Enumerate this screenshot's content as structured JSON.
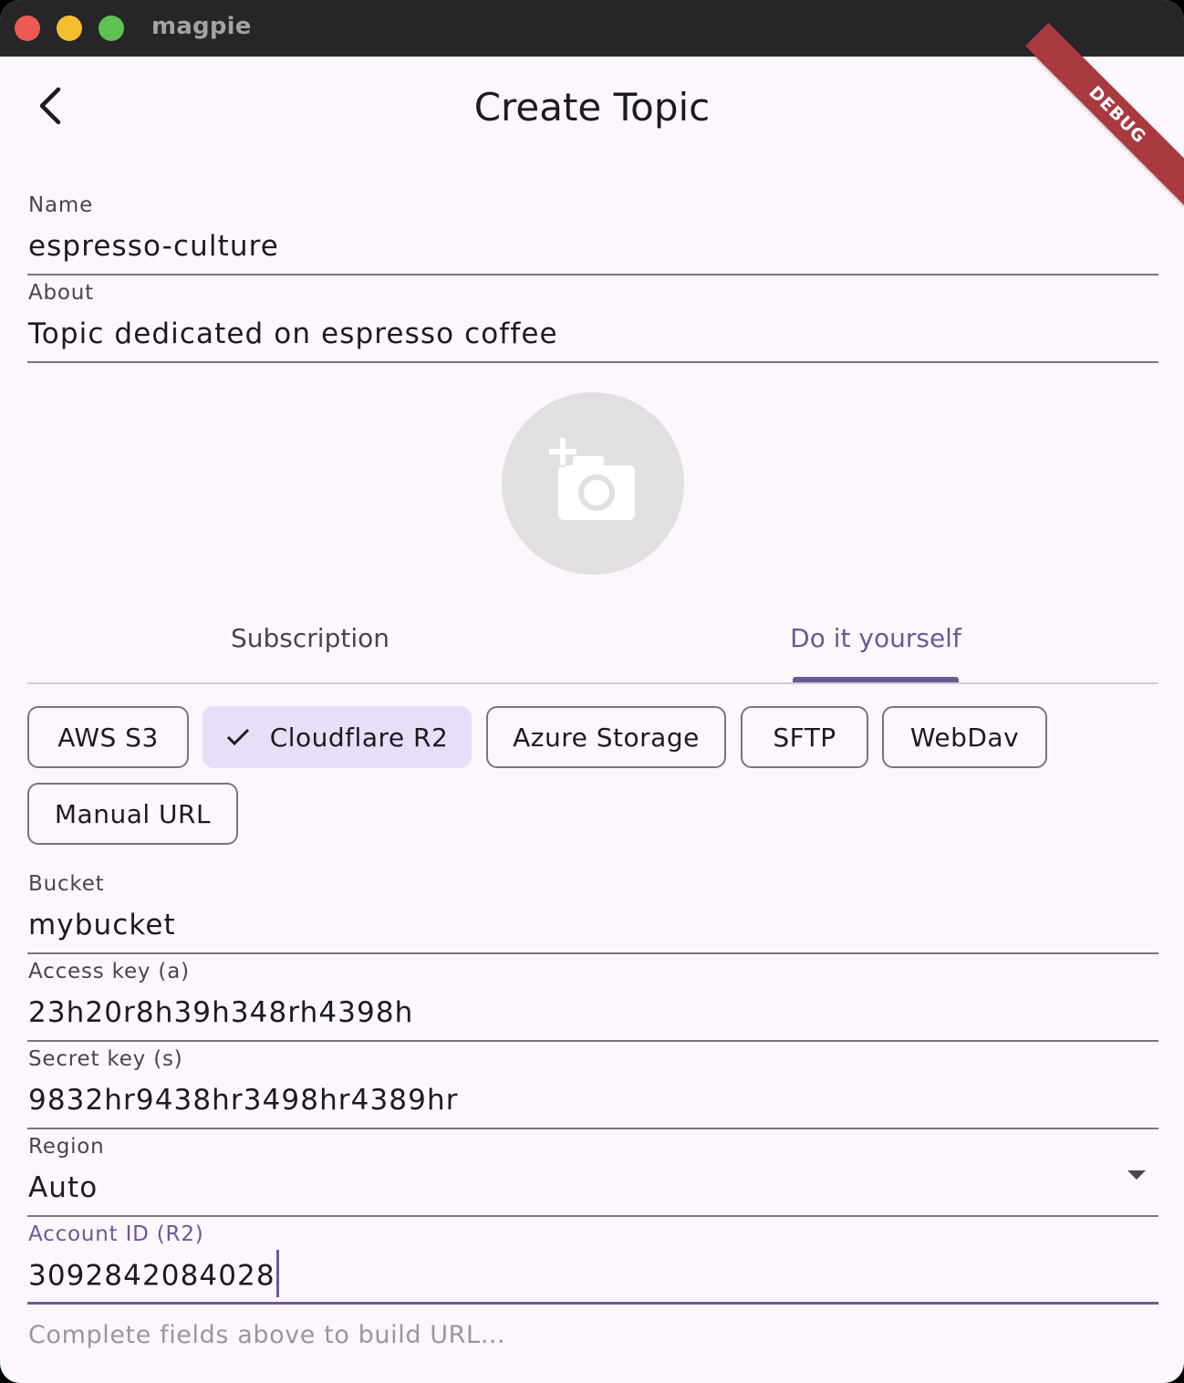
{
  "window": {
    "app_title": "magpie",
    "debug_banner": "DEBUG"
  },
  "header": {
    "title": "Create Topic"
  },
  "form": {
    "name": {
      "label": "Name",
      "value": "espresso-culture"
    },
    "about": {
      "label": "About",
      "value": "Topic dedicated on espresso coffee"
    }
  },
  "tabs": {
    "subscription": "Subscription",
    "diy": "Do it yourself",
    "active": "Do it yourself"
  },
  "providers": {
    "aws": "AWS S3",
    "cloudflare": "Cloudflare R2",
    "azure": "Azure Storage",
    "sftp": "SFTP",
    "webdav": "WebDav",
    "manual": "Manual URL",
    "selected": "Cloudflare R2"
  },
  "storage": {
    "bucket": {
      "label": "Bucket",
      "value": "mybucket"
    },
    "access_key": {
      "label": "Access key (a)",
      "value": "23h20r8h39h348rh4398h"
    },
    "secret_key": {
      "label": "Secret key (s)",
      "value": "9832hr9438hr3498hr4389hr"
    },
    "region": {
      "label": "Region",
      "value": "Auto"
    },
    "account_id": {
      "label": "Account ID (R2)",
      "value": "3092842084028"
    }
  },
  "hint": "Complete fields above to build URL…",
  "colors": {
    "accent": "#6a5a92",
    "selected_chip": "#e8def8",
    "background": "#fdf7fd",
    "debug": "#a83a3f"
  },
  "icons": {
    "back": "arrow-back-icon",
    "avatar": "add-photo-icon",
    "check": "check-icon",
    "dropdown": "arrow-drop-down-icon"
  }
}
